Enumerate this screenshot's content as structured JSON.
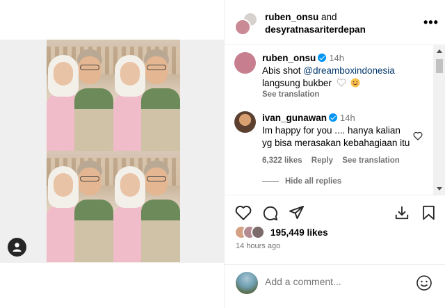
{
  "post": {
    "author": "ruben_onsu",
    "and": "and",
    "collaborator": "desyratnasariterdepan",
    "more_icon": "more-horizontal-icon"
  },
  "comments": [
    {
      "user": "ruben_onsu",
      "verified": true,
      "time": "14h",
      "text_before": "Abis shot ",
      "mention": "@dreamboxindonesia",
      "text_after": " langsung bukber",
      "emojis": [
        "white-heart-icon",
        "smiling-face-icon"
      ],
      "see_translation": "See translation"
    },
    {
      "user": "ivan_gunawan",
      "verified": true,
      "time": "14h",
      "text": "Im happy for you .... hanya kalian yg bisa merasakan kebahagiaan itu",
      "likes": "6,322 likes",
      "reply": "Reply",
      "see_translation": "See translation",
      "hide_replies": "Hide all replies"
    }
  ],
  "actions": {
    "like_icon": "heart-icon",
    "comment_icon": "comment-icon",
    "share_icon": "send-icon",
    "download_icon": "download-icon",
    "save_icon": "bookmark-icon"
  },
  "likes": {
    "count": "195,449 likes"
  },
  "time_ago": "14 hours ago",
  "add_comment": {
    "placeholder": "Add a comment..."
  },
  "colors": {
    "verified": "#0095f6",
    "mention": "#00376b",
    "muted": "#737373",
    "divider": "#efefef"
  }
}
